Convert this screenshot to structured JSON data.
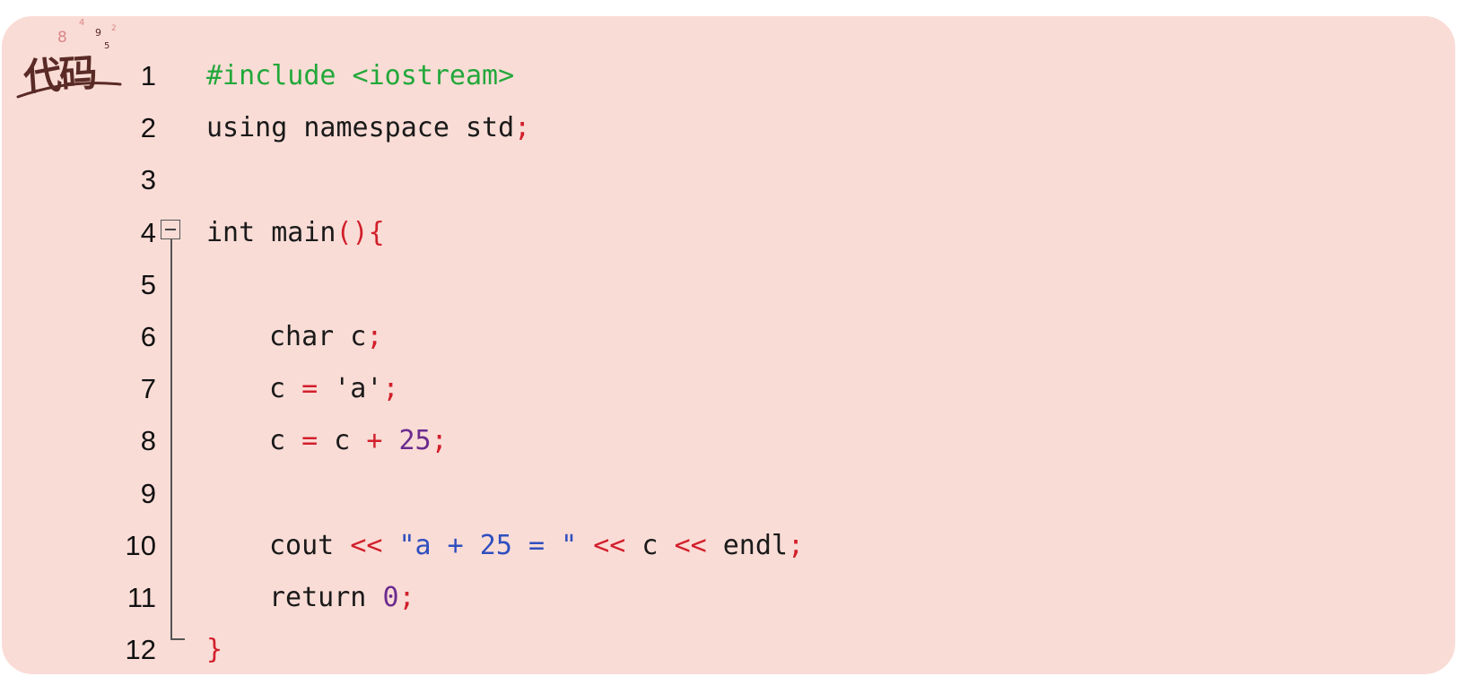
{
  "logo": {
    "label": "代码",
    "digits": [
      "8",
      "4",
      "9",
      "5",
      "2"
    ]
  },
  "code": {
    "lines": [
      {
        "num": "1",
        "segments": [
          {
            "t": "#include <iostream>",
            "c": "pre"
          }
        ]
      },
      {
        "num": "2",
        "segments": [
          {
            "t": "using namespace std",
            "c": "plain"
          },
          {
            "t": ";",
            "c": "op"
          }
        ]
      },
      {
        "num": "3",
        "segments": []
      },
      {
        "num": "4",
        "segments": [
          {
            "t": "int main",
            "c": "plain"
          },
          {
            "t": "(){",
            "c": "op"
          }
        ]
      },
      {
        "num": "5",
        "segments": []
      },
      {
        "num": "6",
        "indent": true,
        "segments": [
          {
            "t": "char c",
            "c": "plain"
          },
          {
            "t": ";",
            "c": "op"
          }
        ]
      },
      {
        "num": "7",
        "indent": true,
        "segments": [
          {
            "t": "c ",
            "c": "plain"
          },
          {
            "t": "=",
            "c": "op"
          },
          {
            "t": " 'a'",
            "c": "plain"
          },
          {
            "t": ";",
            "c": "op"
          }
        ]
      },
      {
        "num": "8",
        "indent": true,
        "segments": [
          {
            "t": "c ",
            "c": "plain"
          },
          {
            "t": "=",
            "c": "op"
          },
          {
            "t": " c ",
            "c": "plain"
          },
          {
            "t": "+",
            "c": "op"
          },
          {
            "t": " ",
            "c": "plain"
          },
          {
            "t": "25",
            "c": "num"
          },
          {
            "t": ";",
            "c": "op"
          }
        ]
      },
      {
        "num": "9",
        "segments": []
      },
      {
        "num": "10",
        "indent": true,
        "segments": [
          {
            "t": "cout ",
            "c": "plain"
          },
          {
            "t": "<<",
            "c": "op"
          },
          {
            "t": " ",
            "c": "plain"
          },
          {
            "t": "\"a + 25 = \"",
            "c": "str"
          },
          {
            "t": " ",
            "c": "plain"
          },
          {
            "t": "<<",
            "c": "op"
          },
          {
            "t": " c ",
            "c": "plain"
          },
          {
            "t": "<<",
            "c": "op"
          },
          {
            "t": " endl",
            "c": "plain"
          },
          {
            "t": ";",
            "c": "op"
          }
        ]
      },
      {
        "num": "11",
        "indent": true,
        "segments": [
          {
            "t": "return ",
            "c": "plain"
          },
          {
            "t": "0",
            "c": "num"
          },
          {
            "t": ";",
            "c": "op"
          }
        ]
      },
      {
        "num": "12",
        "segments": [
          {
            "t": "}",
            "c": "op"
          }
        ]
      }
    ]
  },
  "colors": {
    "background": "#fadcd6",
    "preprocessor": "#22a83a",
    "operator": "#d21f2b",
    "number": "#6b2c8f",
    "string": "#2f4fbf",
    "text": "#1a1a1a"
  }
}
